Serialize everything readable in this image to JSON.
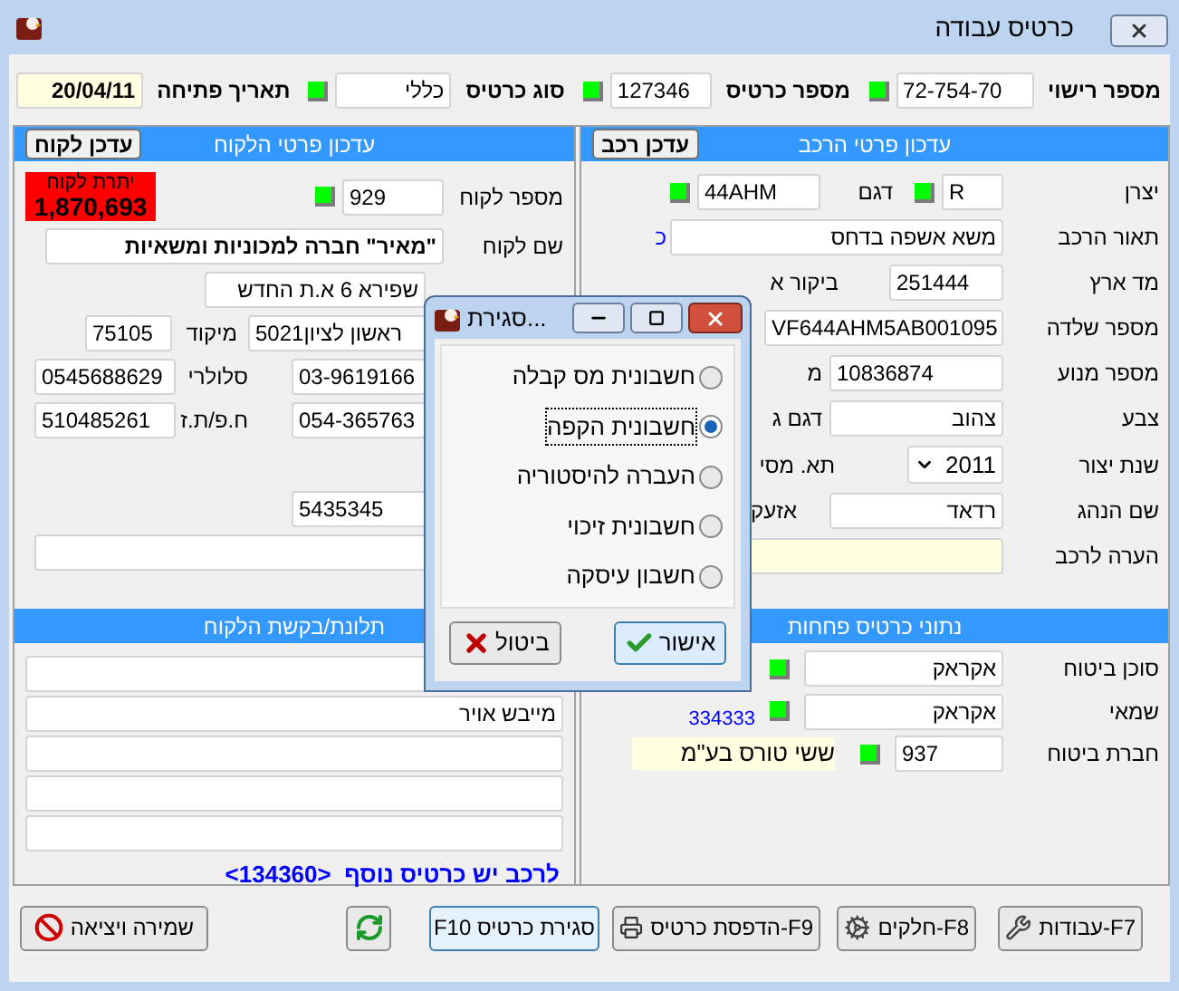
{
  "window": {
    "title": "כרטיס עבודה"
  },
  "header": [
    {
      "label": "מספר רישוי",
      "value": "72-754-70",
      "ok": true
    },
    {
      "label": "מספר כרטיס",
      "value": "127346",
      "ok": true
    },
    {
      "label": "סוג כרטיס",
      "value": "כללי",
      "ok": true
    },
    {
      "label": "תאריך פתיחה",
      "value": "20/04/11"
    }
  ],
  "vehicle": {
    "title": "עדכון פרטי הרכב",
    "button": "עדכן רכב",
    "maker": {
      "label": "יצרן",
      "value": "R",
      "ok": true
    },
    "model": {
      "label": "דגם",
      "value": "44AHM",
      "ok": true
    },
    "description": {
      "label": "תאור הרכב",
      "value": "משא אשפה בדחס",
      "side": "כ"
    },
    "odometer": {
      "label": "מד ארץ",
      "value": "251444",
      "side": "ביקור א"
    },
    "chassis": {
      "label": "מספר שלדה",
      "value": "VF644AHM5AB001095"
    },
    "engine": {
      "label": "מספר מנוע",
      "value": "10836874",
      "side": "מ"
    },
    "color": {
      "label": "צבע",
      "value": "צהוב",
      "side": "דגם ג"
    },
    "year": {
      "label": "שנת יצור",
      "value": "2011",
      "side": "תא. מסי"
    },
    "driver": {
      "label": "שם הנהג",
      "value": "רדאד",
      "side": "אזעק"
    },
    "note": {
      "label": "הערה לרכב"
    }
  },
  "customer": {
    "title": "עדכון פרטי הלקוח",
    "button": "עדכן לקוח",
    "balance": {
      "label": "יתרת לקוח",
      "value": "1,870,693"
    },
    "number": {
      "label": "מספר לקוח",
      "value": "929",
      "ok": true
    },
    "name": {
      "label": "שם לקוח",
      "value": "\"מאיר\" חברה למכוניות ומשאיות"
    },
    "address": "שפירא 6 א.ת החדש",
    "city": "ראשון לציון5021",
    "zip": {
      "label": "מיקוד",
      "value": "75105"
    },
    "phone": "03-9619166",
    "mobile": {
      "label": "סלולרי",
      "value": "0545688629"
    },
    "phone2": "054-365763",
    "company_id": {
      "label": "ח.פ/ת.ז",
      "value": "510485261"
    },
    "fax": "5435345"
  },
  "complaints": {
    "title": "תלונת/בקשת הלקוח",
    "lines": [
      "מייבש אויר"
    ],
    "notice": "לרכב יש כרטיס נוסף  <134360>"
  },
  "insurance": {
    "title": "נתוני כרטיס פחחות",
    "agent": {
      "label": "סוכן ביטוח",
      "value": "אקראק",
      "ok": true
    },
    "appraiser": {
      "label": "שמאי",
      "value": "אקראק",
      "ok": true,
      "side": "334333"
    },
    "company": {
      "label": "חברת ביטוח",
      "value": "937",
      "ok": true,
      "name": "ששי טורס בע\"מ"
    }
  },
  "toolbar": [
    {
      "kind": "works",
      "label": "F7-עבודות"
    },
    {
      "kind": "parts",
      "label": "F8-חלקים"
    },
    {
      "kind": "print",
      "label": "F9-הדפסת כרטיס"
    },
    {
      "kind": "close",
      "label": "סגירת כרטיס F10"
    },
    {
      "kind": "refresh"
    },
    {
      "kind": "exit",
      "label": "שמירה ויציאה"
    }
  ],
  "dialog": {
    "title": "סגירת...",
    "options": [
      {
        "label": "חשבונית מס קבלה",
        "selected": false
      },
      {
        "label": "חשבונית הקפה",
        "selected": true
      },
      {
        "label": "העברה להיסטוריה",
        "selected": false
      },
      {
        "label": "חשבונית זיכוי",
        "selected": false
      },
      {
        "label": "חשבון עיסקה",
        "selected": false
      }
    ],
    "ok": "אישור",
    "cancel": "ביטול"
  }
}
